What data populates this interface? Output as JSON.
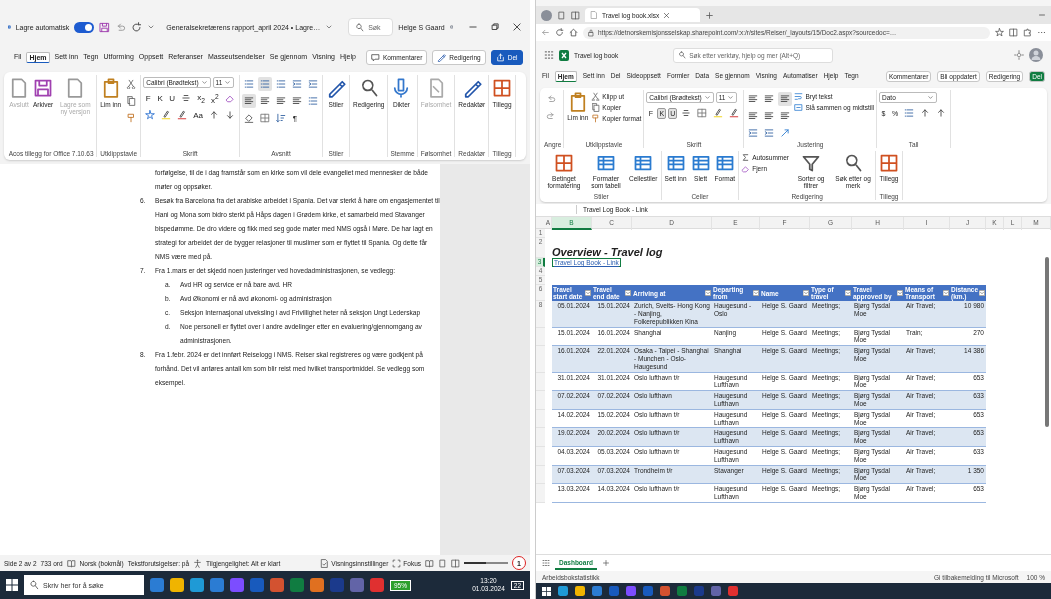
{
  "word": {
    "title_bar": {
      "autosave_label": "Lagre automatisk",
      "autosave_on": true,
      "document_title": "Generalsekretærens rapport_april 2024 • Lagre…",
      "search_placeholder": "Søk",
      "user": "Helge S Gaard"
    },
    "tabs": [
      {
        "label": "Fil",
        "selected": false
      },
      {
        "label": "Hjem",
        "selected": true
      },
      {
        "label": "Sett inn",
        "selected": false
      },
      {
        "label": "Tegn",
        "selected": false
      },
      {
        "label": "Utforming",
        "selected": false
      },
      {
        "label": "Oppsett",
        "selected": false
      },
      {
        "label": "Referanser",
        "selected": false
      },
      {
        "label": "Masseutsendelser",
        "selected": false
      },
      {
        "label": "Se gjennom",
        "selected": false
      },
      {
        "label": "Visning",
        "selected": false
      },
      {
        "label": "Hjelp",
        "selected": false
      }
    ],
    "actions": [
      "Kommentarer",
      "Redigering",
      "Del"
    ],
    "ribbon": [
      {
        "kind": "buttons",
        "label": "Acos tillegg for Office 7.10.63",
        "buttons": [
          {
            "label": "Avslutt",
            "kind": "large",
            "disabled": true
          },
          {
            "label": "Arkiver",
            "kind": "large",
            "disabled": false
          },
          {
            "label": "Lagre som ny versjon",
            "kind": "large",
            "disabled": true
          }
        ]
      },
      {
        "kind": "buttons",
        "label": "Utklippstavle",
        "buttons": [
          {
            "label": "Lim inn",
            "kind": "large",
            "disabled": false
          }
        ],
        "rows": [
          [
            {
              "kind": "cut"
            }
          ],
          [
            {
              "kind": "copy"
            }
          ],
          [
            {
              "kind": "painter"
            }
          ]
        ]
      },
      {
        "kind": "tools",
        "label": "Skrift",
        "fields": [
          {
            "value": "Calibri (Brødtekst)",
            "kind": "wide"
          },
          {
            "value": "11",
            "kind": "narrow"
          }
        ],
        "rows": [
          [
            {
              "kind": "key",
              "label": "F",
              "pressed": false
            },
            {
              "kind": "key",
              "label": "K",
              "pressed": false
            },
            {
              "kind": "key",
              "label": "U",
              "pressed": false
            },
            {
              "kind": "strike"
            },
            {
              "kind": "key",
              "label": "x$_{2}$",
              "pressed": false
            },
            {
              "kind": "key",
              "label": "x$^{2}$",
              "pressed": false
            },
            {
              "kind": "clear"
            }
          ],
          [
            {
              "kind": "effects"
            },
            {
              "kind": "highlight"
            },
            {
              "kind": "fontcolor"
            },
            {
              "kind": "key",
              "label": "Aa",
              "pressed": false
            },
            {
              "kind": "grow"
            },
            {
              "kind": "shrink"
            }
          ]
        ]
      },
      {
        "kind": "tools",
        "label": "Avsnitt",
        "rows": [
          [
            {
              "kind": "bullets",
              "pressed": false
            },
            {
              "kind": "numbering",
              "pressed": true
            },
            {
              "kind": "multilevel",
              "pressed": false
            },
            {
              "kind": "outdent"
            },
            {
              "kind": "indent"
            }
          ],
          [
            {
              "kind": "align",
              "pressed": true
            },
            {
              "kind": "align",
              "pressed": false
            },
            {
              "kind": "align",
              "pressed": false
            },
            {
              "kind": "align",
              "pressed": false
            },
            {
              "kind": "spacing"
            }
          ],
          [
            {
              "kind": "shading"
            },
            {
              "kind": "borders"
            },
            {
              "kind": "sort"
            },
            {
              "kind": "key",
              "label": "¶",
              "pressed": false
            }
          ]
        ]
      },
      {
        "kind": "buttons",
        "label": "Stiler",
        "buttons": [
          {
            "label": "Stiler",
            "kind": "large",
            "disabled": false
          }
        ]
      },
      {
        "kind": "buttons",
        "buttons": [
          {
            "label": "Redigering",
            "kind": "large",
            "disabled": false
          }
        ]
      },
      {
        "kind": "buttons",
        "label": "Stemme",
        "buttons": [
          {
            "label": "Dikter",
            "kind": "large",
            "disabled": false
          }
        ]
      },
      {
        "kind": "buttons",
        "label": "Følsomhet",
        "buttons": [
          {
            "label": "Følsomhet",
            "kind": "large",
            "disabled": true
          }
        ]
      },
      {
        "kind": "buttons",
        "label": "Redaktør",
        "buttons": [
          {
            "label": "Redaktør",
            "kind": "large",
            "disabled": false
          }
        ]
      },
      {
        "kind": "buttons",
        "label": "Tillegg",
        "buttons": [
          {
            "label": "Tillegg",
            "kind": "large",
            "disabled": false
          }
        ]
      }
    ],
    "document": {
      "lead": "forfølgelse, til de i dag framstår som en kirke som vil dele evangeliet med mennesker de både møter og oppsøker.",
      "items": [
        {
          "marker": "6.",
          "text": "Besøk fra Barcelona fra det arabiske arbeidet i Spania. Det var sterkt å høre om engasjementet til Hani og Mona som bidro sterkt på Håps dagen i Grødem kirke, et samarbeid med Stavanger bispedømme.  De dro videre og fikk med seg gode møter med NMS også i Møre. De har lagt en strategi for arbeidet der de bygger relasjoner til muslimer som er flyttet til Spania. Og dette får NMS være med på."
        },
        {
          "marker": "7.",
          "text": "Fra 1.mars er det skjedd noen justeringer ved hovedadministrasjonen, se vedlegg:",
          "children": [
            {
              "marker": "a.",
              "text": "Avd HR og service er nå bare avd. HR"
            },
            {
              "marker": "b.",
              "text": "Avd Økonomi er nå avd økonomi- og administrasjon"
            },
            {
              "marker": "c.",
              "text": "Seksjon Internasjonal utveksling i avd Frivillighet heter nå seksjon Ungt Lederskap"
            },
            {
              "marker": "d.",
              "text": "Noe personell er flyttet over i andre avdelinger etter en evaluering/gjennomgang av administrasjonen."
            }
          ]
        },
        {
          "marker": "8.",
          "text": "Fra 1.febr. 2024 er det innført Reiselogg i NMS. Reiser skal registreres og være godkjent på forhånd. Det vil anføres antall km som blir reist med hvilket transportmiddel. Se vedlegg som eksempel."
        }
      ]
    },
    "status_bar": {
      "items": [
        "Side 2 av 2",
        "733 ord",
        "Norsk (bokmål)",
        "Tekstforutsigelser: på",
        "Tilgjengelighet: Alt er klart"
      ],
      "view_settings": "Visningsinnstillinger",
      "focus": "Fokus",
      "zoom": {
        "level": 0.45
      }
    }
  },
  "annotation": "1",
  "excel": {
    "browser": {
      "tab_title": "Travel log book.xlsx",
      "url": "https://detnorskemisjonsselskap.sharepoint.com/:x:/r/sites/Reiser/_layouts/15/Doc2.aspx?sourcedoc=…"
    },
    "app": {
      "file_name": "Travel log book",
      "search_placeholder": "Søk etter verktøy, hjelp og mer (Alt+Q)"
    },
    "tabs": [
      {
        "label": "Fil",
        "selected": false
      },
      {
        "label": "Hjem",
        "selected": true
      },
      {
        "label": "Sett inn",
        "selected": false
      },
      {
        "label": "Del",
        "selected": false
      },
      {
        "label": "Sideoppsett",
        "selected": false
      },
      {
        "label": "Formler",
        "selected": false
      },
      {
        "label": "Data",
        "selected": false
      },
      {
        "label": "Se gjennom",
        "selected": false
      },
      {
        "label": "Visning",
        "selected": false
      },
      {
        "label": "Automatiser",
        "selected": false
      },
      {
        "label": "Hjelp",
        "selected": false
      },
      {
        "label": "Tegn",
        "selected": false
      }
    ],
    "actions": [
      "Kommentarer",
      "Bli oppdatert",
      "Redigering",
      "Del"
    ],
    "ribbon": [
      {
        "kind": "tools",
        "label": "Angre",
        "rows": [
          [
            {
              "kind": "undo"
            }
          ],
          [
            {
              "kind": "redo"
            }
          ]
        ]
      },
      {
        "kind": "buttons",
        "label": "Utklippstavle",
        "buttons": [
          {
            "label": "Lim inn",
            "kind": "large"
          },
          {
            "label": "Klipp ut",
            "kind": "small"
          },
          {
            "label": "Kopier",
            "kind": "small"
          },
          {
            "label": "Kopier format",
            "kind": "small"
          }
        ]
      },
      {
        "kind": "tools",
        "label": "Skrift",
        "fields": [
          {
            "value": "Calibri (Brødtekst)",
            "kind": "wide"
          },
          {
            "value": "11",
            "kind": "narrow"
          }
        ],
        "rows": [
          [
            {
              "kind": "key",
              "label": "F",
              "pressed": false
            },
            {
              "kind": "key",
              "label": "K",
              "pressed": true
            },
            {
              "kind": "key",
              "label": "U",
              "pressed": true
            },
            {
              "kind": "strike"
            },
            {
              "kind": "borders"
            },
            {
              "kind": "highlight"
            },
            {
              "kind": "fontcolor"
            }
          ]
        ]
      },
      {
        "kind": "tools",
        "label": "Justering",
        "rows": [
          [
            {
              "kind": "align",
              "pressed": false
            },
            {
              "kind": "align",
              "pressed": false
            },
            {
              "kind": "align",
              "pressed": true
            }
          ],
          [
            {
              "kind": "align",
              "pressed": false
            },
            {
              "kind": "align",
              "pressed": false
            },
            {
              "kind": "align",
              "pressed": false
            }
          ],
          [
            {
              "kind": "outdent"
            },
            {
              "kind": "indent"
            },
            {
              "kind": "orientation"
            }
          ]
        ],
        "buttons": [
          {
            "label": "Bryt tekst",
            "kind": "small"
          },
          {
            "label": "Slå sammen og midtstill",
            "kind": "small"
          }
        ]
      },
      {
        "kind": "tools",
        "label": "Tall",
        "fields": [
          {
            "value": "Dato",
            "kind": "wide"
          }
        ],
        "rows": [
          [
            {
              "kind": "key",
              "label": "$",
              "pressed": false
            },
            {
              "kind": "key",
              "label": "%",
              "pressed": false
            },
            {
              "kind": "comma"
            },
            {
              "kind": "decimals"
            },
            {
              "kind": "decimals"
            }
          ]
        ]
      },
      {
        "kind": "buttons",
        "label": "Stiler",
        "buttons": [
          {
            "label": "Betinget formatering",
            "kind": "large"
          },
          {
            "label": "Formater som tabell",
            "kind": "large"
          },
          {
            "label": "Cellestiler",
            "kind": "large"
          }
        ]
      },
      {
        "kind": "buttons",
        "label": "Celler",
        "buttons": [
          {
            "label": "Sett inn",
            "kind": "large"
          },
          {
            "label": "Slett",
            "kind": "large"
          },
          {
            "label": "Format",
            "kind": "large"
          }
        ]
      },
      {
        "kind": "buttons",
        "label": "Redigering",
        "buttons": [
          {
            "label": "Autosummer",
            "kind": "small"
          },
          {
            "label": "Fjern",
            "kind": "small"
          },
          {
            "label": "Sorter og filtrer",
            "kind": "large"
          },
          {
            "label": "Søk etter og merk",
            "kind": "large"
          }
        ]
      },
      {
        "kind": "buttons",
        "label": "Tillegg",
        "buttons": [
          {
            "label": "Tillegg",
            "kind": "large"
          }
        ]
      }
    ],
    "formula_bar": {
      "value": "Travel Log Book - Link"
    },
    "sheet": {
      "columns": [
        {
          "label": "A",
          "selected": false
        },
        {
          "label": "B",
          "selected": true
        },
        {
          "label": "C",
          "selected": false
        },
        {
          "label": "D",
          "selected": false
        },
        {
          "label": "E",
          "selected": false
        },
        {
          "label": "F",
          "selected": false
        },
        {
          "label": "G",
          "selected": false
        },
        {
          "label": "H",
          "selected": false
        },
        {
          "label": "I",
          "selected": false
        },
        {
          "label": "J",
          "selected": false
        },
        {
          "label": "K",
          "selected": false
        },
        {
          "label": "L",
          "selected": false
        },
        {
          "label": "M",
          "selected": false
        }
      ],
      "row_labels": [
        {
          "label": "1",
          "selected": false
        },
        {
          "label": "2",
          "selected": false
        },
        {
          "label": "3",
          "selected": true
        },
        {
          "label": "4",
          "selected": false
        },
        {
          "label": "5",
          "selected": false
        },
        {
          "label": "6",
          "selected": false
        }
      ],
      "title": "Overview - Travel log",
      "link": "Travel Log Book - Link",
      "table": {
        "headers": [
          "Travel start date",
          "Travel end date",
          "Arriving at",
          "Departing from",
          "Name",
          "Type of travel",
          "Travel approved by",
          "Means of Transport",
          "Distance (km.)"
        ],
        "rows": [
          {
            "row_label": "8",
            "cells": [
              "05.01.2024",
              "15.01.2024",
              "Zurich, Sveits- Hong Kong - Nanjing, Folkerepublikken Kina",
              "Haugesund - Oslo",
              "Helge S. Gaard",
              "Meetings;",
              "Bjørg Tysdal Moe",
              "Air Travel;",
              "10 980"
            ]
          },
          {
            "cells": [
              "15.01.2024",
              "16.01.2024",
              "Shanghai",
              "Nanjing",
              "Helge S. Gaard",
              "Meetings;",
              "Bjørg Tysdal Moe",
              "Train;",
              "270"
            ]
          },
          {
            "cells": [
              "16.01.2024",
              "22.01.2024",
              "Osaka - Taipei - Shanghai - Munchen - Oslo- Haugesund",
              "Shanghai",
              "Helge S. Gaard",
              "Meetings;",
              "Bjørg Tysdal Moe",
              "Air Travel;",
              "14 386"
            ]
          },
          {
            "cells": [
              "31.01.2024",
              "31.01.2024",
              "Oslo lufthavn t/r",
              "Haugesund Lufthavn",
              "Helge S. Gaard",
              "Meetings;",
              "Bjørg Tysdal Moe",
              "Air Travel;",
              "653"
            ]
          },
          {
            "cells": [
              "07.02.2024",
              "07.02.2024",
              "Oslo lufthavn",
              "Haugesund Lufthavn",
              "Helge S. Gaard",
              "Meetings;",
              "Bjørg Tysdal Moe",
              "Air Travel;",
              "633"
            ]
          },
          {
            "cells": [
              "14.02.2024",
              "15.02.2024",
              "Oslo lufthavn t/r",
              "Haugesund Lufthavn",
              "Helge S. Gaard",
              "Meetings;",
              "Bjørg Tysdal Moe",
              "Air Travel;",
              "653"
            ]
          },
          {
            "cells": [
              "19.02.2024",
              "20.02.2024",
              "Oslo lufthavn t/r",
              "Haugesund Lufthavn",
              "Helge S. Gaard",
              "Meetings;",
              "Bjørg Tysdal Moe",
              "Air Travel;",
              "653"
            ]
          },
          {
            "cells": [
              "04.03.2024",
              "05.03.2024",
              "Oslo lufthavn t/r",
              "Haugesund Lufthavn",
              "Helge S. Gaard",
              "Meetings;",
              "Bjørg Tysdal Moe",
              "Air Travel;",
              "633"
            ]
          },
          {
            "cells": [
              "07.03.2024",
              "07.03.2024",
              "Trondheim t/r",
              "Stavanger",
              "Helge S. Gaard",
              "Meetings;",
              "Bjørg Tysdal Moe",
              "Air Travel;",
              "1 350"
            ]
          },
          {
            "cells": [
              "13.03.2024",
              "14.03.2024",
              "Oslo lufthavn t/r",
              "Haugesund Lufthavn",
              "Helge S. Gaard",
              "Meetings;",
              "Bjørg Tysdal Moe",
              "Air Travel;",
              "653"
            ]
          }
        ]
      }
    },
    "sheet_tabs": [
      {
        "label": "Dashboard",
        "selected": true
      }
    ],
    "status_bar": {
      "stats": "Arbeidsbokstatistikk",
      "feedback": "Gi tilbakemelding til Microsoft",
      "zoom": "100 %"
    }
  },
  "taskbar": {
    "search_placeholder": "Skriv her for å søke",
    "battery": "95%",
    "time": "13:20",
    "date": "01.03.2024",
    "notifications": "22"
  }
}
